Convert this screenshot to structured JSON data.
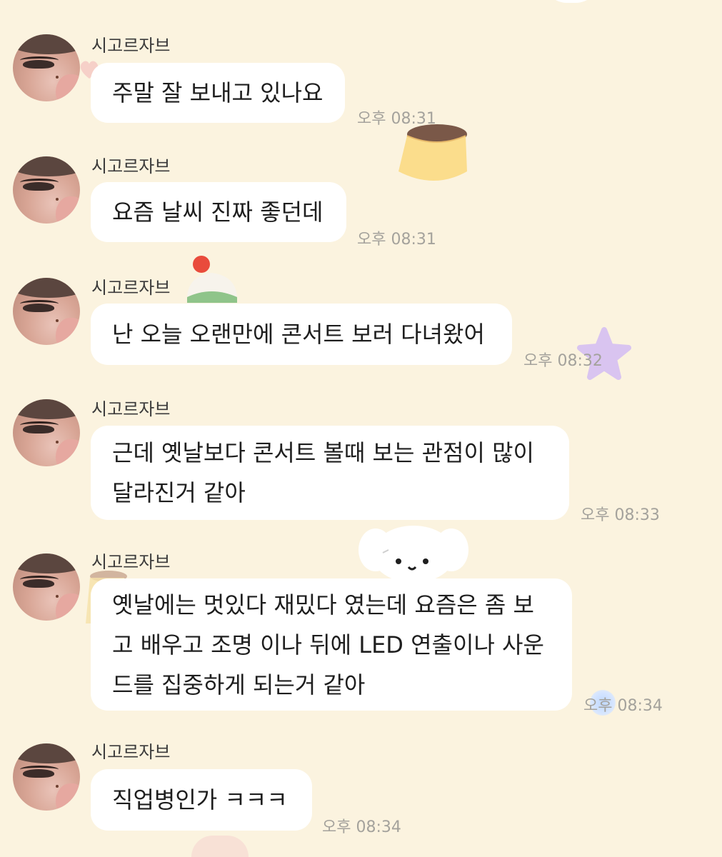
{
  "sender": "시고르자브",
  "messages": [
    {
      "lines": [
        "주말 잘 보내고 있나요"
      ],
      "time": "오후 08:31"
    },
    {
      "lines": [
        "요즘 날씨 진짜 좋던데"
      ],
      "time": "오후 08:31"
    },
    {
      "lines": [
        "난 오늘 오랜만에 콘서트 보러 다녀왔어"
      ],
      "time": "오후 08:32"
    },
    {
      "lines": [
        "근데 옛날보다 콘서트 볼때 보는 관점이 많이",
        "달라진거 같아"
      ],
      "time": "오후 08:33"
    },
    {
      "lines": [
        "옛날에는 멋있다 재밌다 였는데 요즘은 좀 보",
        "고 배우고 조명 이나 뒤에 LED 연출이나 사운",
        "드를 집중하게 되는거 같아"
      ],
      "time": "오후 08:34"
    },
    {
      "lines": [
        "직업병인가 ㅋㅋㅋ"
      ],
      "time": "오후 08:34"
    }
  ],
  "decorations": {
    "pudding": "pudding-sticker-icon",
    "cake": "strawberry-cake-sticker-icon",
    "star": "purple-star-sticker-icon",
    "puppy": "white-puppy-sticker-icon"
  },
  "colors": {
    "background": "#FBF3DF",
    "bubble": "#FFFFFF",
    "timestamp": "#A4A29C",
    "text": "#1E1E1E"
  }
}
